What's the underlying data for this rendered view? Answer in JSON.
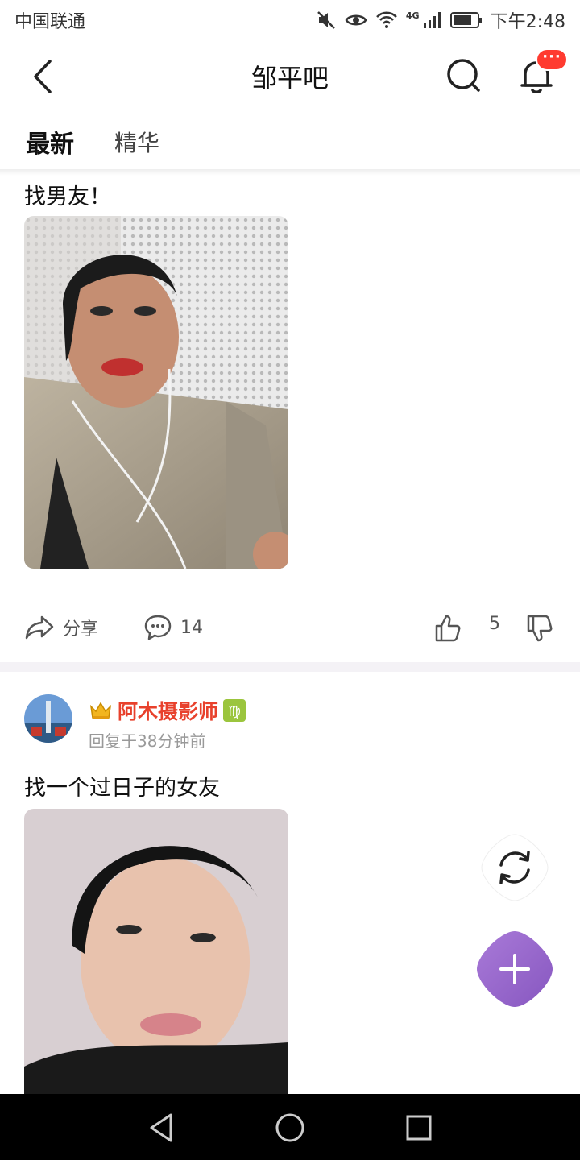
{
  "status_bar": {
    "carrier": "中国联通",
    "network": "4G",
    "time": "下午2:48"
  },
  "nav": {
    "title": "邹平吧",
    "badge": "···"
  },
  "tabs": [
    {
      "label": "最新",
      "active": true
    },
    {
      "label": "精华",
      "active": false
    }
  ],
  "posts": [
    {
      "text": "找男友！",
      "share_label": "分享",
      "comment_count": "14",
      "like_count": "5"
    },
    {
      "author": "阿木摄影师",
      "meta": "回复于38分钟前",
      "text": "找一个过日子的女友"
    }
  ],
  "colors": {
    "accent_purple": "#9b6ad0",
    "author_red": "#e8412c",
    "badge_red": "#ff3b30"
  },
  "icons": [
    "back-icon",
    "search-icon",
    "bell-icon",
    "share-icon",
    "comment-icon",
    "thumbs-up-icon",
    "thumbs-down-icon",
    "crown-icon",
    "virgo-icon",
    "refresh-icon",
    "plus-icon"
  ]
}
